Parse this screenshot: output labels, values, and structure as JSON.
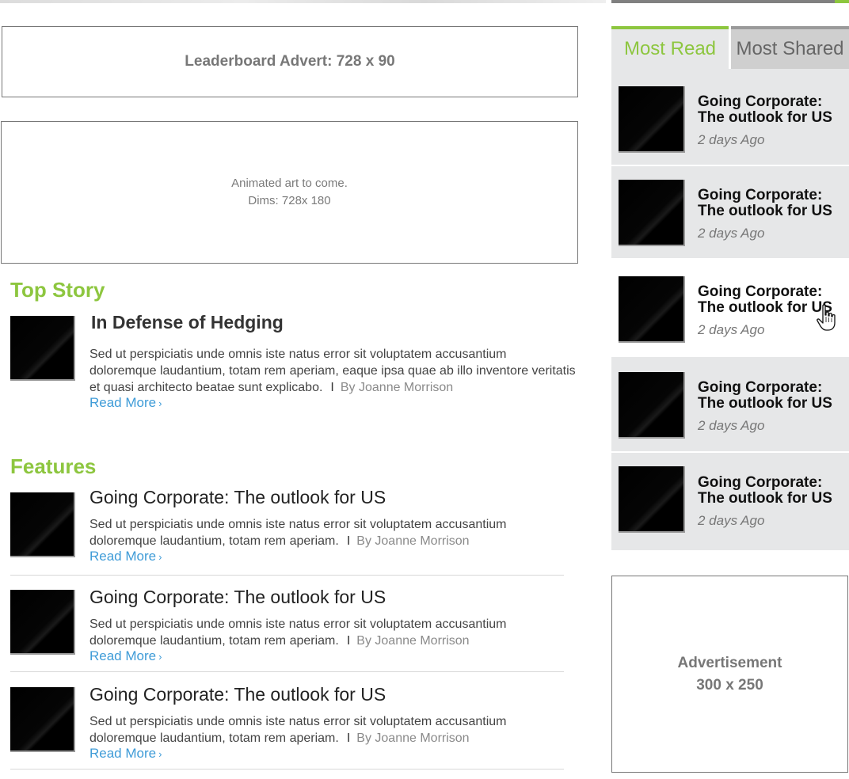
{
  "ads": {
    "leaderboard": "Leaderboard Advert: 728 x 90",
    "animated_line1": "Animated art to come.",
    "animated_line2": "Dims: 728x 180",
    "sidebar_line1": "Advertisement",
    "sidebar_line2": "300 x 250"
  },
  "top_story": {
    "heading": "Top Story",
    "title": "In Defense of Hedging",
    "body": "Sed ut perspiciatis unde omnis iste natus error sit voluptatem accusantium doloremque laudantium, totam rem aperiam, eaque ipsa quae ab illo inventore veritatis et quasi architecto beatae sunt explicabo.",
    "separator": "I",
    "byline": "By Joanne Morrison",
    "read_more": "Read More",
    "read_more_chevron": "›"
  },
  "features": {
    "heading": "Features",
    "items": [
      {
        "title": "Going Corporate: The outlook for US",
        "body": "Sed ut perspiciatis unde omnis iste natus error sit voluptatem accusantium doloremque laudantium, totam rem aperiam.",
        "separator": "I",
        "byline": "By Joanne Morrison",
        "read_more": "Read More",
        "read_more_chevron": "›"
      },
      {
        "title": "Going Corporate: The outlook for US",
        "body": "Sed ut perspiciatis unde omnis iste natus error sit voluptatem accusantium doloremque laudantium, totam rem aperiam.",
        "separator": "I",
        "byline": "By Joanne Morrison",
        "read_more": "Read More",
        "read_more_chevron": "›"
      },
      {
        "title": "Going Corporate: The outlook for US",
        "body": "Sed ut perspiciatis unde omnis iste natus error sit voluptatem accusantium doloremque laudantium, totam rem aperiam.",
        "separator": "I",
        "byline": "By Joanne Morrison",
        "read_more": "Read More",
        "read_more_chevron": "›"
      }
    ]
  },
  "sidebar": {
    "tabs": [
      {
        "label": "Most Read",
        "active": true
      },
      {
        "label": "Most Shared",
        "active": false
      }
    ],
    "most_read": [
      {
        "title_line1": "Going Corporate:",
        "title_line2": "The outlook for US",
        "time": "2 days Ago"
      },
      {
        "title_line1": "Going Corporate:",
        "title_line2": "The outlook for US",
        "time": "2 days Ago"
      },
      {
        "title_line1": "Going Corporate:",
        "title_line2": "The outlook for US",
        "time": "2 days Ago"
      },
      {
        "title_line1": "Going Corporate:",
        "title_line2": "The outlook for US",
        "time": "2 days Ago"
      },
      {
        "title_line1": "Going Corporate:",
        "title_line2": "The outlook for US",
        "time": "2 days Ago"
      }
    ]
  },
  "colors": {
    "accent_green": "#8dc63f",
    "link_blue": "#3e9bd7",
    "sidebar_bg": "#e6e7e8"
  },
  "icons": {
    "cursor": "hand-pointer-icon",
    "chevron": "chevron-right-icon"
  }
}
